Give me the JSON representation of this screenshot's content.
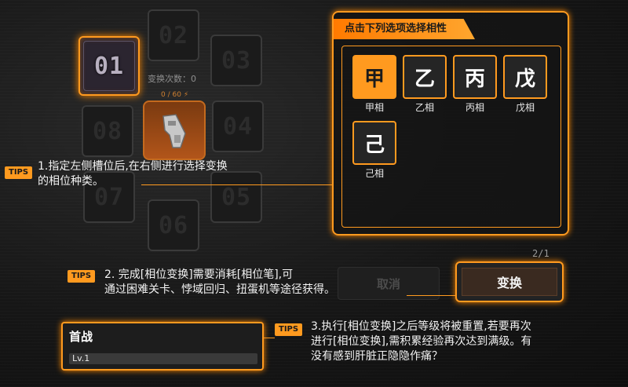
{
  "colors": {
    "accent": "#ff9a1f",
    "panel_bg": "#141414"
  },
  "slots": [
    {
      "label": "01",
      "active": true
    },
    {
      "label": "02"
    },
    {
      "label": "03"
    },
    {
      "label": "04"
    },
    {
      "label": "05"
    },
    {
      "label": "06"
    },
    {
      "label": "07"
    },
    {
      "label": "08"
    }
  ],
  "transform_count_label": "变换次数：0",
  "energy_label": "0 / 60",
  "panel": {
    "title": "点击下列选项选择相性",
    "options": [
      {
        "glyph": "甲",
        "label": "甲相",
        "selected": true
      },
      {
        "glyph": "乙",
        "label": "乙相"
      },
      {
        "glyph": "丙",
        "label": "丙相"
      },
      {
        "glyph": "戊",
        "label": "戊相"
      },
      {
        "glyph": "己",
        "label": "己相"
      }
    ]
  },
  "page_indicator": "2/1",
  "cancel_label": "取消",
  "action_label": "变换",
  "level_box": {
    "title": "首战",
    "level": "Lv.1"
  },
  "tips": [
    {
      "badge": "TIPS",
      "text_line1": "1.指定左侧槽位后,在右侧进行选择变换",
      "text_line2": "的相位种类。"
    },
    {
      "badge": "TIPS",
      "text_line1": "2. 完成[相位变换]需要消耗[相位笔],可",
      "text_line2": "通过困难关卡、悖域回归、扭蛋机等途径获得。"
    },
    {
      "badge": "TIPS",
      "text_line1": "3.执行[相位变换]之后等级将被重置,若要再次",
      "text_line2": "进行[相位变换],需积累经验再次达到满级。有",
      "text_line3": "没有感到肝脏正隐隐作痛？"
    }
  ]
}
